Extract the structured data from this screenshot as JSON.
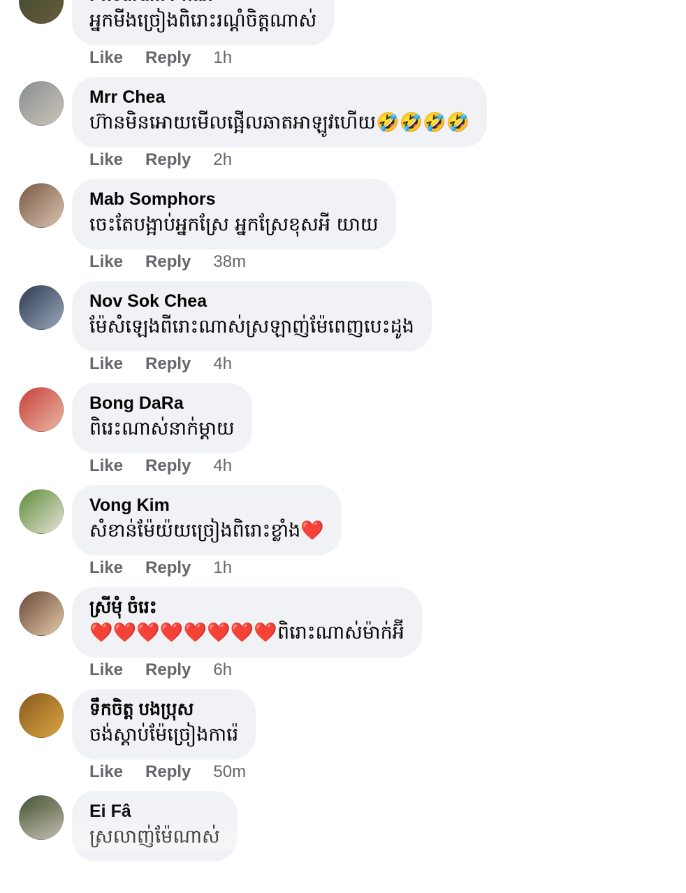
{
  "comments": [
    {
      "author": "Pheurum Phan",
      "text": "អ្នកមីងច្រៀងពិរោះរណ្ដំចិត្តណាស់",
      "time": "1h",
      "avatar_colors": [
        "#3d4a2e",
        "#6b5b3e"
      ]
    },
    {
      "author": "Mrr Chea",
      "text": "ហ៊ានមិនអោយមើលផ្អើលឆាតអាឡូវហើយ🤣🤣🤣🤣",
      "time": "2h",
      "avatar_colors": [
        "#8a8f93",
        "#c9c4b8"
      ]
    },
    {
      "author": "Mab Somphors",
      "text": "ចេះតែបង្អាប់អ្នកស្រែ អ្នកស្រែខុសអី យាយ",
      "time": "38m",
      "avatar_colors": [
        "#7a5a45",
        "#d8c2b0"
      ]
    },
    {
      "author": "Nov Sok Chea",
      "text": "ម៉ែសំឡេងពីរោះណាស់ស្រឡាញ់ម៉ែពេញបេះដូង",
      "time": "4h",
      "avatar_colors": [
        "#2e3a52",
        "#9aa6b8"
      ]
    },
    {
      "author": "Bong DaRa",
      "text": "ពិរេះណាស់នាក់ម្ដាយ",
      "time": "4h",
      "avatar_colors": [
        "#c9413a",
        "#e8b7a3"
      ]
    },
    {
      "author": "Vong Kim",
      "text": "សំខាន់ម៉ែយ៉យច្រៀងពិរោះខ្លាំង❤️",
      "time": "1h",
      "avatar_colors": [
        "#5e8c3a",
        "#e6e2d6"
      ]
    },
    {
      "author": "ស្រីមុំ ចំរេះ",
      "text": "❤️❤️❤️❤️❤️❤️❤️❤️ពិរោះណាស់ម៉ាក់អ៊ី",
      "time": "6h",
      "avatar_colors": [
        "#6b4a3a",
        "#e2c8a8"
      ]
    },
    {
      "author": "ទឹកចិត្ត បងប្រុស",
      "text": "ចង់ស្ដាប់ម៉ែច្រៀងការ៉េ",
      "time": "50m",
      "avatar_colors": [
        "#8a5a1e",
        "#d9a441"
      ]
    },
    {
      "author": "Ei Fâ",
      "text": "ស្រលាញ់ម៉ែណាស់",
      "time": "",
      "avatar_colors": [
        "#4a5a3a",
        "#a8a290"
      ]
    }
  ],
  "labels": {
    "like": "Like",
    "reply": "Reply"
  },
  "colors": {
    "bubble": "#f0f2f5",
    "name": "#050505",
    "meta": "#65676b"
  }
}
